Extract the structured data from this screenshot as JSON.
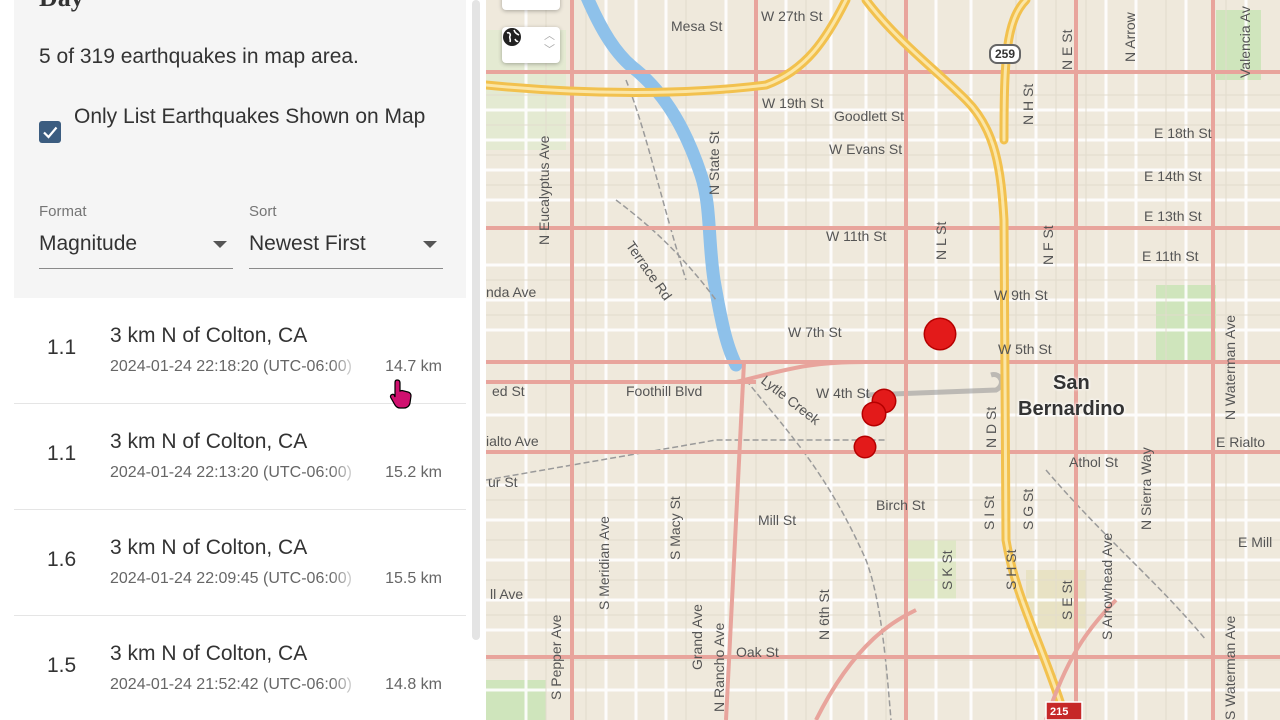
{
  "panel": {
    "title_partial": "Day",
    "count_text": "5 of 319 earthquakes in map area.",
    "only_list_label": "Only List Earthquakes Shown on Map",
    "only_list_checked": true,
    "format_label": "Format",
    "format_value": "Magnitude",
    "sort_label": "Sort",
    "sort_value": "Newest First"
  },
  "earthquakes": [
    {
      "mag": "1.1",
      "place": "3 km N of Colton, CA",
      "time": "2024-01-24 22:18:20 (UTC-06:00)",
      "depth": "14.7 km"
    },
    {
      "mag": "1.1",
      "place": "3 km N of Colton, CA",
      "time": "2024-01-24 22:13:20 (UTC-06:00)",
      "depth": "15.2 km"
    },
    {
      "mag": "1.6",
      "place": "3 km N of Colton, CA",
      "time": "2024-01-24 22:09:45 (UTC-06:00)",
      "depth": "15.5 km"
    },
    {
      "mag": "1.5",
      "place": "3 km N of Colton, CA",
      "time": "2024-01-24 21:52:42 (UTC-06:00)",
      "depth": "14.8 km"
    }
  ],
  "map": {
    "city_line1": "San",
    "city_line2": "Bernardino",
    "shield_259": "259",
    "shield_215": "215",
    "labels": {
      "mesa_st": "Mesa St",
      "w27th": "W 27th St",
      "w19th": "W 19th St",
      "goodlett": "Goodlett St",
      "w_evans": "W Evans St",
      "w11th": "W 11th St",
      "w9th": "W 9th St",
      "w7th": "W 7th St",
      "w5th": "W 5th St",
      "w4th": "W 4th St",
      "foothill": "Foothill Blvd",
      "lytle": "Lytle Creek",
      "rialto": "Rialto Ave",
      "athol": "Athol St",
      "birch": "Birch St",
      "mill": "Mill St",
      "oak": "Oak St",
      "e18th": "E 18th St",
      "e14th": "E 14th St",
      "e13th": "E 13th St",
      "e11th": "E 11th St",
      "e_mill": "E Mill",
      "e_rialto": "E Rialto",
      "enda_ave": "nda Ave",
      "ed_st": "ed St",
      "ialto_ave": "ialto Ave",
      "ur_st": "ur St",
      "ll_ave": "ll Ave",
      "terrace": "Terrace Rd",
      "n_eucalyptus": "N Eucalyptus Ave",
      "n_state": "N State St",
      "s_meridian": "S Meridian Ave",
      "s_macy": "S Macy St",
      "grand_ave": "Grand Ave",
      "n_rancho": "N Rancho Ave",
      "n_6th": "N 6th St",
      "s_pepper": "S Pepper Ave",
      "n_l": "N L St",
      "n_h": "N H St",
      "n_e": "N E St",
      "n_f": "N F St",
      "n_d": "N D St",
      "s_i": "S I St",
      "s_g": "S G St",
      "s_k": "S K St",
      "s_h": "S H St",
      "s_e": "S E St",
      "n_arrow": "N Arrow",
      "n_sierra": "N Sierra Way",
      "s_arrowhead": "S Arrowhead Ave",
      "n_waterman": "N Waterman Ave",
      "s_waterman": "S Waterman Ave",
      "valencia": "Valencia Av"
    }
  },
  "colors": {
    "quake": "#e31a1a",
    "checkbox": "#3c5d80",
    "freeway": "#f2c14e",
    "arterial": "#e8a49c",
    "river": "#8ec1ea"
  }
}
